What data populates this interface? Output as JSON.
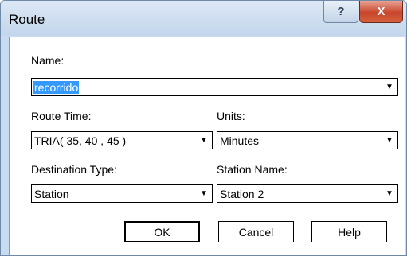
{
  "window": {
    "title": "Route"
  },
  "titlebar": {
    "help_glyph": "?",
    "close_glyph": "X"
  },
  "fields": {
    "name": {
      "label": "Name:",
      "value": "recorrido"
    },
    "route_time": {
      "label": "Route Time:",
      "value": "TRIA( 35, 40 , 45 )"
    },
    "units": {
      "label": "Units:",
      "value": "Minutes"
    },
    "destination_type": {
      "label": "Destination Type:",
      "value": "Station"
    },
    "station_name": {
      "label": "Station Name:",
      "value": "Station 2"
    }
  },
  "buttons": {
    "ok": "OK",
    "cancel": "Cancel",
    "help": "Help"
  },
  "icons": {
    "dropdown": "chevron-down-icon"
  }
}
